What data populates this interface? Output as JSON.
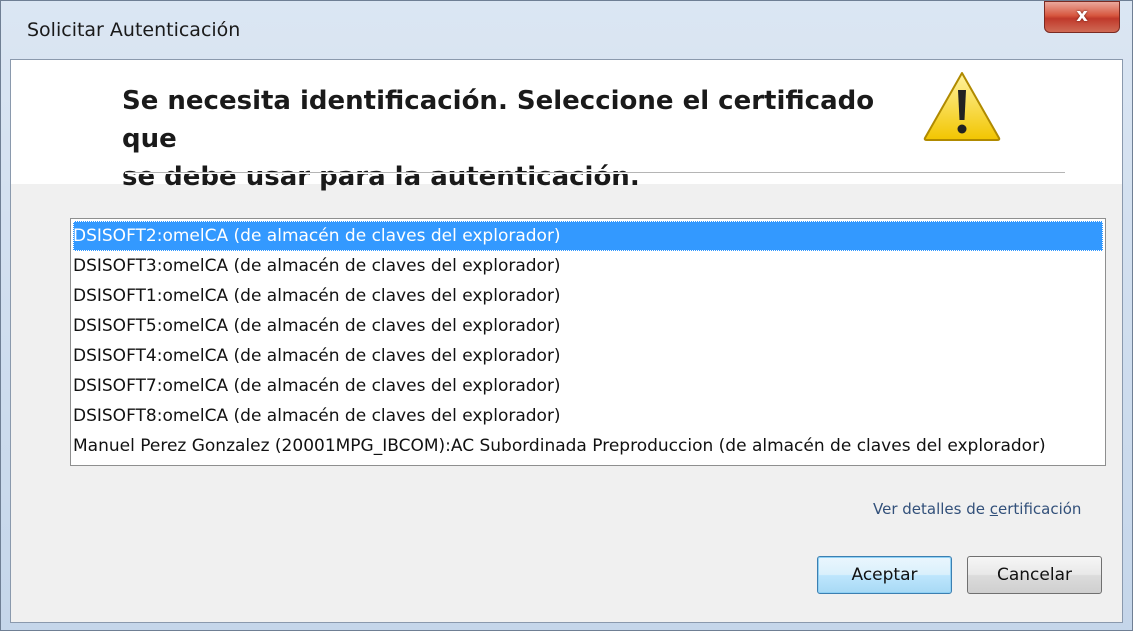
{
  "window": {
    "title": "Solicitar Autenticación",
    "close_label": "x"
  },
  "banner": {
    "heading_line1": "Se necesita identificación. Seleccione el certificado que",
    "heading_line2": "se debe usar para la autenticación.",
    "icon": "warning-icon",
    "icon_color": "#f5d300"
  },
  "certificates": {
    "items": [
      {
        "label": "DSISOFT2:omelCA (de almacén de claves del explorador)",
        "selected": true
      },
      {
        "label": "DSISOFT3:omelCA (de almacén de claves del explorador)",
        "selected": false
      },
      {
        "label": "DSISOFT1:omelCA (de almacén de claves del explorador)",
        "selected": false
      },
      {
        "label": "DSISOFT5:omelCA (de almacén de claves del explorador)",
        "selected": false
      },
      {
        "label": "DSISOFT4:omelCA (de almacén de claves del explorador)",
        "selected": false
      },
      {
        "label": "DSISOFT7:omelCA (de almacén de claves del explorador)",
        "selected": false
      },
      {
        "label": "DSISOFT8:omelCA (de almacén de claves del explorador)",
        "selected": false
      },
      {
        "label": "Manuel Perez Gonzalez (20001MPG_IBCOM):AC Subordinada Preproduccion (de almacén de claves del explorador)",
        "selected": false
      }
    ],
    "selection_color": "#3399ff"
  },
  "details_link": {
    "prefix": "Ver detalles de ",
    "accel": "c",
    "suffix": "ertificación"
  },
  "buttons": {
    "accept_label": "Aceptar",
    "cancel_label": "Cancelar"
  }
}
